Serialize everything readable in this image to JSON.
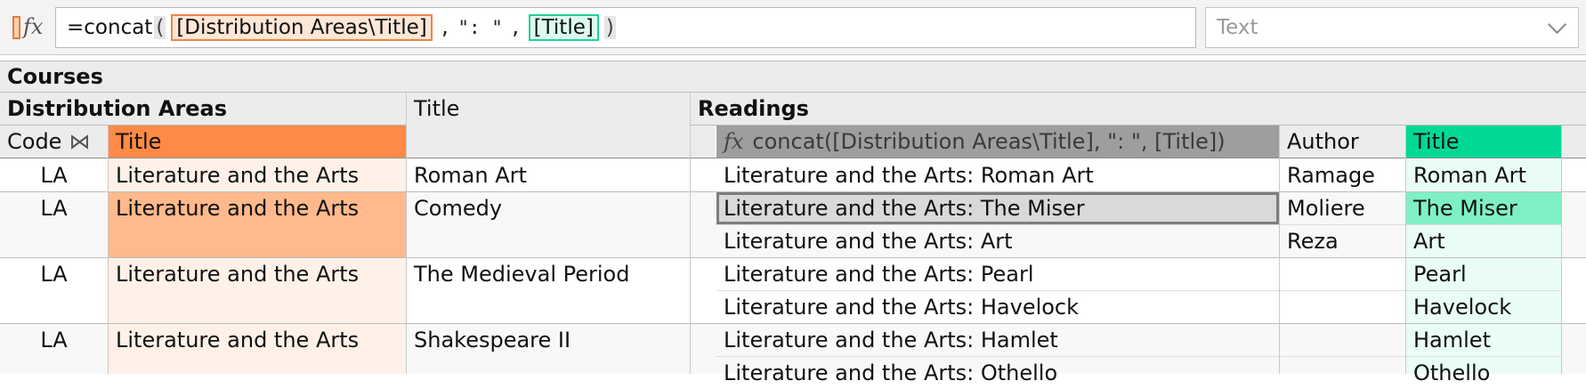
{
  "formula_bar": {
    "prefix": "=concat",
    "open_paren": "(",
    "arg1": "[Distribution Areas\\Title]",
    "separator_before": ",",
    "string_literal": "\": \"",
    "separator_after": ",",
    "arg2": "[Title]",
    "close_paren": ")",
    "type_value": "Text"
  },
  "colors": {
    "orange_header": "#ff8a46",
    "orange_selected": "#ffb98c",
    "orange_light": "#fff1e8",
    "green_header": "#00d896",
    "green_selected": "#7ff0c6",
    "green_light": "#e9fdf4",
    "header_bg": "#ececec"
  },
  "headers": {
    "courses": "Courses",
    "distribution_areas": "Distribution Areas",
    "title": "Title",
    "readings": "Readings",
    "code": "Code",
    "code_icon": "⋈",
    "da_title": "Title",
    "formula_col": "concat([Distribution Areas\\Title], \": \", [Title])",
    "author": "Author",
    "reading_title": "Title"
  },
  "rows": [
    {
      "code": "LA",
      "da_title": "Literature and the Arts",
      "course_title": "Roman Art",
      "readings": [
        {
          "concat": "Literature and the Arts: Roman Art",
          "author": "Ramage",
          "title": "Roman Art"
        }
      ]
    },
    {
      "code": "LA",
      "da_title": "Literature and the Arts",
      "course_title": "Comedy",
      "readings": [
        {
          "concat": "Literature and the Arts: The Miser",
          "author": "Moliere",
          "title": "The Miser"
        },
        {
          "concat": "Literature and the Arts: Art",
          "author": "Reza",
          "title": "Art"
        }
      ]
    },
    {
      "code": "LA",
      "da_title": "Literature and the Arts",
      "course_title": "The Medieval Period",
      "readings": [
        {
          "concat": "Literature and the Arts: Pearl",
          "author": "",
          "title": "Pearl"
        },
        {
          "concat": "Literature and the Arts: Havelock",
          "author": "",
          "title": "Havelock"
        }
      ]
    },
    {
      "code": "LA",
      "da_title": "Literature and the Arts",
      "course_title": "Shakespeare II",
      "readings": [
        {
          "concat": "Literature and the Arts: Hamlet",
          "author": "",
          "title": "Hamlet"
        },
        {
          "concat": "Literature and the Arts: Othello",
          "author": "",
          "title": "Othello"
        }
      ]
    }
  ]
}
